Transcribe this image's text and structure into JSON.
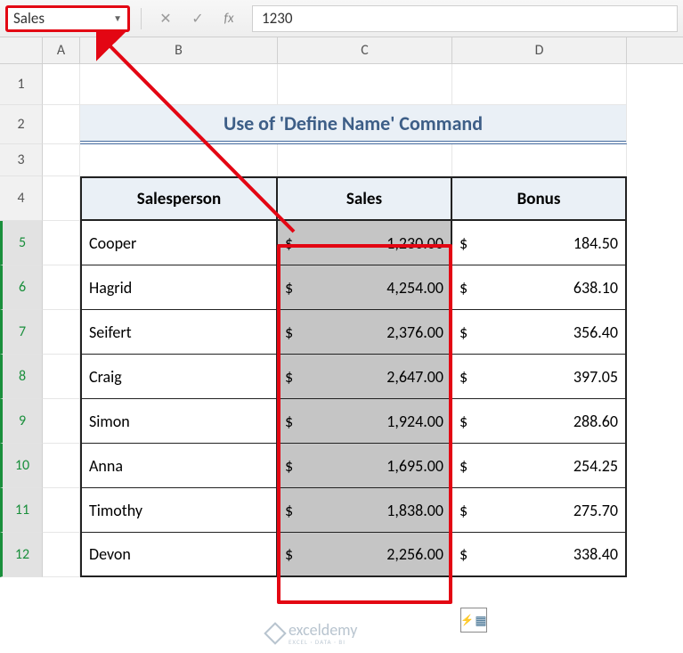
{
  "formula_bar": {
    "name_box": "Sales",
    "fx_label": "fx",
    "formula_value": "1230"
  },
  "columns": {
    "A": "A",
    "B": "B",
    "C": "C",
    "D": "D"
  },
  "row_labels": [
    "1",
    "2",
    "3",
    "4",
    "5",
    "6",
    "7",
    "8",
    "9",
    "10",
    "11",
    "12"
  ],
  "title": "Use of 'Define Name' Command",
  "headers": {
    "salesperson": "Salesperson",
    "sales": "Sales",
    "bonus": "Bonus"
  },
  "currency_symbol": "$",
  "rows": [
    {
      "name": "Cooper",
      "sales": "1,230.00",
      "bonus": "184.50"
    },
    {
      "name": "Hagrid",
      "sales": "4,254.00",
      "bonus": "638.10"
    },
    {
      "name": "Seifert",
      "sales": "2,376.00",
      "bonus": "356.40"
    },
    {
      "name": "Craig",
      "sales": "2,647.00",
      "bonus": "397.05"
    },
    {
      "name": "Simon",
      "sales": "1,924.00",
      "bonus": "288.60"
    },
    {
      "name": "Anna",
      "sales": "1,695.00",
      "bonus": "254.25"
    },
    {
      "name": "Timothy",
      "sales": "1,838.00",
      "bonus": "275.70"
    },
    {
      "name": "Devon",
      "sales": "2,256.00",
      "bonus": "338.40"
    }
  ],
  "watermark": {
    "text": "exceldemy",
    "sub": "EXCEL · DATA · BI"
  },
  "chart_data": {
    "type": "table",
    "title": "Use of 'Define Name' Command",
    "columns": [
      "Salesperson",
      "Sales",
      "Bonus"
    ],
    "data": [
      [
        "Cooper",
        1230.0,
        184.5
      ],
      [
        "Hagrid",
        4254.0,
        638.1
      ],
      [
        "Seifert",
        2376.0,
        356.4
      ],
      [
        "Craig",
        2647.0,
        397.05
      ],
      [
        "Simon",
        1924.0,
        288.6
      ],
      [
        "Anna",
        1695.0,
        254.25
      ],
      [
        "Timothy",
        1838.0,
        275.7
      ],
      [
        "Devon",
        2256.0,
        338.4
      ]
    ],
    "named_range": "Sales"
  }
}
